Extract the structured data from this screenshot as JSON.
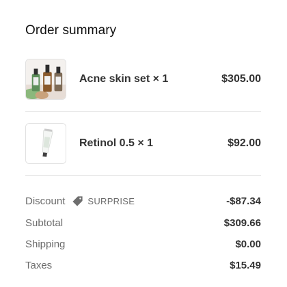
{
  "title": "Order summary",
  "items": [
    {
      "name": "Acne skin set × 1",
      "price": "$305.00",
      "image": "skincare-bottles-photo"
    },
    {
      "name": "Retinol 0.5 × 1",
      "price": "$92.00",
      "image": "retinol-tube-photo"
    }
  ],
  "discount": {
    "label": "Discount",
    "code": "SURPRISE",
    "value": "-$87.34",
    "icon": "tag-icon"
  },
  "subtotal": {
    "label": "Subtotal",
    "value": "$309.66"
  },
  "shipping": {
    "label": "Shipping",
    "value": "$0.00"
  },
  "taxes": {
    "label": "Taxes",
    "value": "$15.49"
  }
}
